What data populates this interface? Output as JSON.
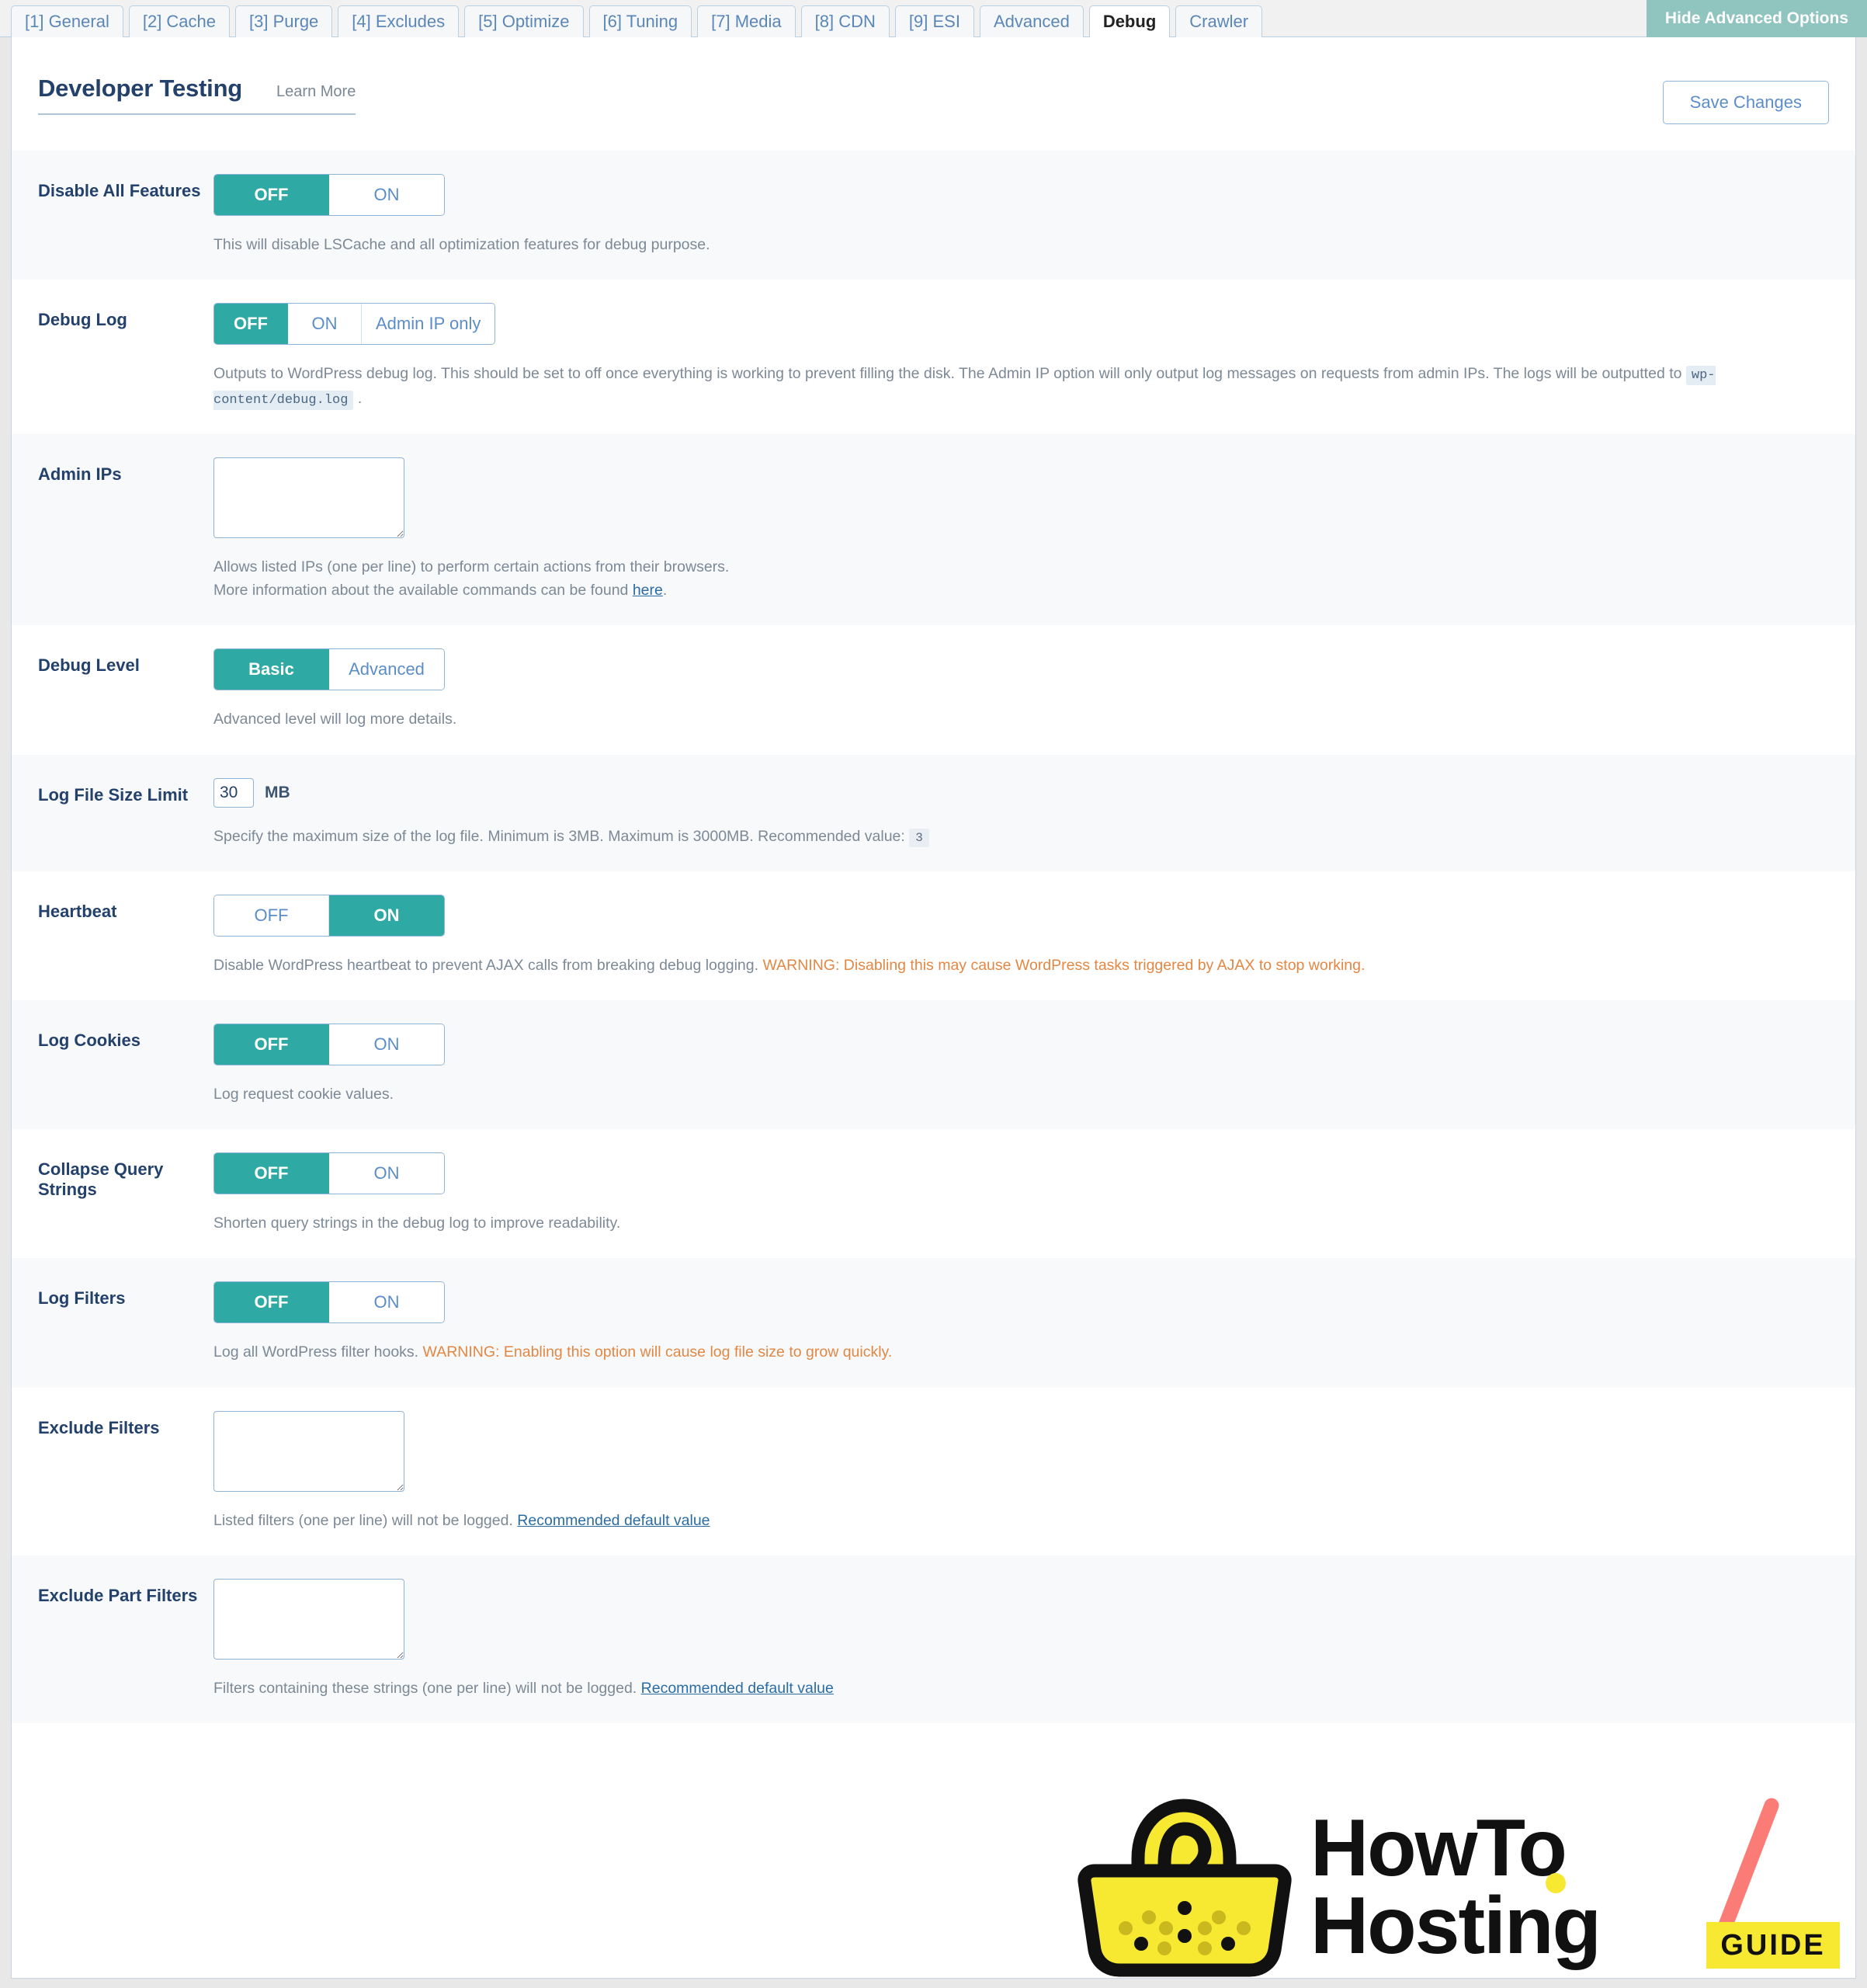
{
  "tabs": [
    {
      "label": "[1] General",
      "active": false
    },
    {
      "label": "[2] Cache",
      "active": false
    },
    {
      "label": "[3] Purge",
      "active": false
    },
    {
      "label": "[4] Excludes",
      "active": false
    },
    {
      "label": "[5] Optimize",
      "active": false
    },
    {
      "label": "[6] Tuning",
      "active": false
    },
    {
      "label": "[7] Media",
      "active": false
    },
    {
      "label": "[8] CDN",
      "active": false
    },
    {
      "label": "[9] ESI",
      "active": false
    },
    {
      "label": "Advanced",
      "active": false
    },
    {
      "label": "Debug",
      "active": true
    },
    {
      "label": "Crawler",
      "active": false
    }
  ],
  "hide_advanced_label": "Hide Advanced Options",
  "header": {
    "title": "Developer Testing",
    "learn_more": "Learn More",
    "save_label": "Save Changes"
  },
  "colors": {
    "accent_teal": "#2fa9a4",
    "link_blue": "#5b8dc8",
    "label_navy": "#23416b",
    "warning_orange": "#e38743",
    "hide_adv_bg": "#8fc4bf",
    "logo_yellow": "#f7e832",
    "logo_slash": "#fb7b76"
  },
  "settings": [
    {
      "label": "Disable All Features",
      "type": "toggle",
      "options": [
        "OFF",
        "ON"
      ],
      "selected": "OFF",
      "desc": "This will disable LSCache and all optimization features for debug purpose."
    },
    {
      "label": "Debug Log",
      "type": "toggle3",
      "options": [
        "OFF",
        "ON",
        "Admin IP only"
      ],
      "selected": "OFF",
      "desc_part1": "Outputs to WordPress debug log. This should be set to off once everything is working to prevent filling the disk. The Admin IP option will only output log messages on requests from admin IPs. The logs will be outputted to ",
      "desc_code": "wp-content/debug.log",
      "desc_part2": "."
    },
    {
      "label": "Admin IPs",
      "type": "textarea",
      "value": "",
      "desc_line1": "Allows listed IPs (one per line) to perform certain actions from their browsers.",
      "desc_line2_pre": "More information about the available commands can be found ",
      "desc_link": "here",
      "desc_line2_post": "."
    },
    {
      "label": "Debug Level",
      "type": "toggle",
      "options": [
        "Basic",
        "Advanced"
      ],
      "selected": "Basic",
      "desc": "Advanced level will log more details."
    },
    {
      "label": "Log File Size Limit",
      "type": "number",
      "value": "30",
      "unit": "MB",
      "desc_pre": "Specify the maximum size of the log file. Minimum is 3MB. Maximum is 3000MB. Recommended value: ",
      "desc_badge": "3"
    },
    {
      "label": "Heartbeat",
      "type": "toggle",
      "options": [
        "OFF",
        "ON"
      ],
      "selected": "ON",
      "desc_pre": "Disable WordPress heartbeat to prevent AJAX calls from breaking debug logging. ",
      "desc_warn": "WARNING: Disabling this may cause WordPress tasks triggered by AJAX to stop working."
    },
    {
      "label": "Log Cookies",
      "type": "toggle",
      "options": [
        "OFF",
        "ON"
      ],
      "selected": "OFF",
      "desc": "Log request cookie values."
    },
    {
      "label": "Collapse Query Strings",
      "type": "toggle",
      "options": [
        "OFF",
        "ON"
      ],
      "selected": "OFF",
      "desc": "Shorten query strings in the debug log to improve readability."
    },
    {
      "label": "Log Filters",
      "type": "toggle",
      "options": [
        "OFF",
        "ON"
      ],
      "selected": "OFF",
      "desc_pre": "Log all WordPress filter hooks. ",
      "desc_warn": "WARNING: Enabling this option will cause log file size to grow quickly."
    },
    {
      "label": "Exclude Filters",
      "type": "textarea",
      "value": "",
      "desc_pre": "Listed filters (one per line) will not be logged. ",
      "desc_link": "Recommended default value"
    },
    {
      "label": "Exclude Part Filters",
      "type": "textarea",
      "value": "",
      "desc_pre": "Filters containing these strings (one per line) will not be logged. ",
      "desc_link": "Recommended default value"
    }
  ],
  "logo": {
    "line1": "HowTo",
    "line2": "Hosting",
    "badge": "GUIDE"
  }
}
